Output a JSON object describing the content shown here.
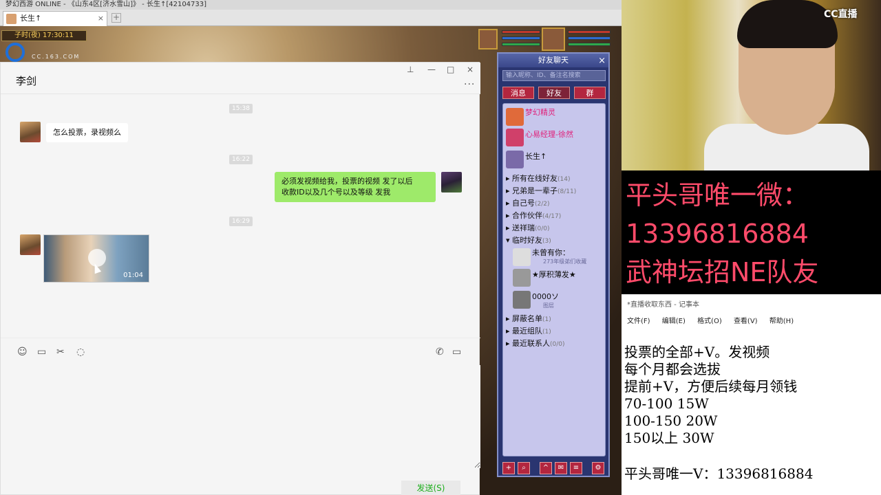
{
  "game": {
    "window_title": "梦幻西游 ONLINE - 《山东4区[济水雪山]》 - 长生↑[42104733]",
    "tab_label": "长生↑",
    "clock": "子时(夜) 17:30:11",
    "watermark_url": "CC.163.COM"
  },
  "chat": {
    "contact_name": "李剑",
    "timestamps": [
      "15:38",
      "16:22",
      "16:29"
    ],
    "messages": [
      {
        "side": "left",
        "text": "怎么投票，录视频么"
      },
      {
        "side": "right",
        "text_line1": "必须发视频给我，投票的视频 发了以后",
        "text_line2": "收款ID以及几个号以及等级 发我"
      }
    ],
    "video_duration": "01:04",
    "send_label": "发送(S)"
  },
  "friends": {
    "title": "好友聊天",
    "search_placeholder": "输入昵称、ID、备注名搜索",
    "tabs": [
      "消息",
      "好友",
      "群"
    ],
    "top_entries": [
      {
        "name": "梦幻精灵"
      },
      {
        "name": "心易经理-徐然"
      },
      {
        "name": "长生↑"
      }
    ],
    "groups": [
      {
        "label": "所有在线好友",
        "count": "(14)"
      },
      {
        "label": "兄弟是一辈子",
        "count": "(8/11)"
      },
      {
        "label": "自己号",
        "count": "(2/2)"
      },
      {
        "label": "合作伙伴",
        "count": "(4/17)"
      },
      {
        "label": "送祥瑞",
        "count": "(0/0)"
      },
      {
        "label": "临时好友",
        "count": "(3)"
      }
    ],
    "temp_friends": [
      {
        "name": "未曾有你：",
        "sub": "273年级弟们收藏"
      },
      {
        "name": "★厚积薄发★",
        "sub": ""
      },
      {
        "name": "0000ソ",
        "sub": "图层"
      }
    ],
    "bottom_groups": [
      {
        "label": "屏蔽名单",
        "count": "(1)"
      },
      {
        "label": "最近组队",
        "count": "(1)"
      },
      {
        "label": "最近联系人",
        "count": "(0/0)"
      }
    ]
  },
  "stream": {
    "brand": "CC直播",
    "promo_lines": [
      "平头哥唯一微：",
      "13396816884",
      "武神坛招NE队友"
    ],
    "notepad_title": "*直播收取东西 - 记事本",
    "notepad_menu": [
      "文件(F)",
      "编辑(E)",
      "格式(O)",
      "查看(V)",
      "帮助(H)"
    ],
    "notepad_lines": [
      "投票的全部+V。发视频",
      "每个月都会选拔",
      "提前+V，方便后续每月领钱",
      "70-100  15W",
      "100-150 20W",
      "150以上 30W",
      "",
      "平头哥唯一V：13396816884"
    ]
  }
}
